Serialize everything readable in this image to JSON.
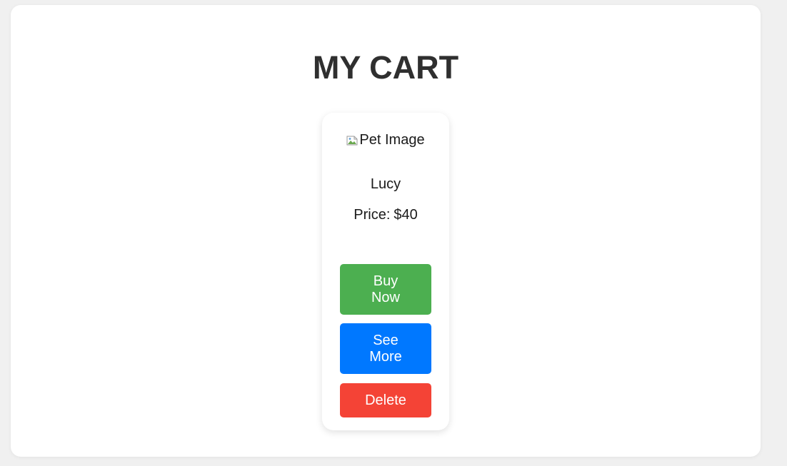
{
  "page": {
    "title": "MY CART"
  },
  "cart": {
    "items": [
      {
        "image_alt": "Pet Image",
        "name": "Lucy",
        "price_label": "Price:",
        "price": "$40",
        "buy_label": "Buy Now",
        "more_label": "See More",
        "delete_label": "Delete"
      }
    ]
  },
  "colors": {
    "buy": "#4caf50",
    "more": "#0078ff",
    "delete": "#f44336",
    "title": "#2f2f2f"
  }
}
